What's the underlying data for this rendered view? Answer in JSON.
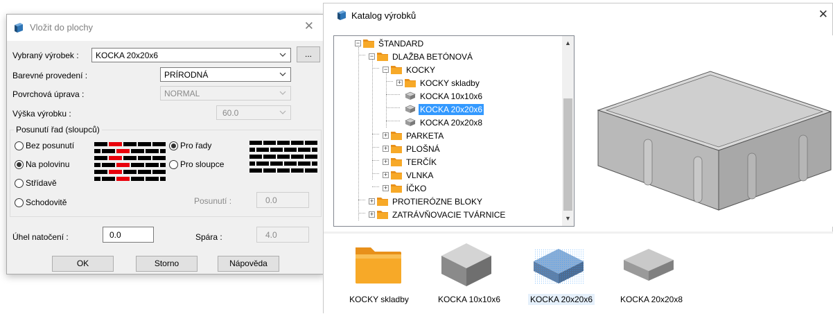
{
  "dialog": {
    "title": "Vložit do plochy",
    "product_label": "Vybraný výrobek :",
    "product_value": "KOCKA 20x20x6",
    "browse_label": "...",
    "color_label": "Barevné provedení :",
    "color_value": "PRÍRODNÁ",
    "surface_label": "Povrchová úprava :",
    "surface_value": "NORMAL",
    "height_label": "Výška výrobku :",
    "height_value": "60.0",
    "shift_group": "Posunutí řad (sloupců)",
    "shift_options": [
      "Bez posunutí",
      "Na polovinu",
      "Střídavě",
      "Schodovitě"
    ],
    "shift_selected": 1,
    "direction_options": [
      "Pro řady",
      "Pro sloupce"
    ],
    "direction_selected": 0,
    "offset_label": "Posunutí :",
    "offset_value": "0.0",
    "angle_label": "Úhel natočení :",
    "angle_value": "0.0",
    "gap_label": "Spára :",
    "gap_value": "4.0",
    "ok_label": "OK",
    "cancel_label": "Storno",
    "help_label": "Nápověda",
    "close_glyph": "✕"
  },
  "catalog": {
    "title": "Katalog výrobků",
    "close_glyph": "✕",
    "tree": [
      {
        "label": "ŠTANDARD",
        "level": 0,
        "type": "folder",
        "expanded": true
      },
      {
        "label": "DLAŽBA BETÓNOVÁ",
        "level": 1,
        "type": "folder",
        "expanded": true
      },
      {
        "label": "KOCKY",
        "level": 2,
        "type": "folder",
        "expanded": true
      },
      {
        "label": "KOCKY skladby",
        "level": 3,
        "type": "folder",
        "expanded": false
      },
      {
        "label": "KOCKA 10x10x6",
        "level": 3,
        "type": "item"
      },
      {
        "label": "KOCKA 20x20x6",
        "level": 3,
        "type": "item",
        "selected": true
      },
      {
        "label": "KOCKA 20x20x8",
        "level": 3,
        "type": "item"
      },
      {
        "label": "PARKETA",
        "level": 2,
        "type": "folder",
        "expanded": false
      },
      {
        "label": "PLOŠNÁ",
        "level": 2,
        "type": "folder",
        "expanded": false
      },
      {
        "label": "TERČÍK",
        "level": 2,
        "type": "folder",
        "expanded": false
      },
      {
        "label": "VLNKA",
        "level": 2,
        "type": "folder",
        "expanded": false
      },
      {
        "label": "ÍČKO",
        "level": 2,
        "type": "folder",
        "expanded": false
      },
      {
        "label": "PROTIERÓZNE BLOKY",
        "level": 1,
        "type": "folder",
        "expanded": false
      },
      {
        "label": "ZATRÁVŇOVACIE TVÁRNICE",
        "level": 1,
        "type": "folder",
        "expanded": false
      }
    ],
    "items": [
      {
        "label": "KOCKY skladby",
        "kind": "folder"
      },
      {
        "label": "KOCKA 10x10x6",
        "kind": "tile-tall"
      },
      {
        "label": "KOCKA 20x20x6",
        "kind": "tile-selected",
        "selected": true
      },
      {
        "label": "KOCKA 20x20x8",
        "kind": "tile-flat"
      }
    ]
  },
  "colors": {
    "selection": "#3399ff",
    "brick_red": "#e8000b",
    "brick_black": "#000000",
    "folder": "#f7a928"
  },
  "icons": [
    "app-icon",
    "close-icon",
    "chevron-down-icon",
    "folder-icon",
    "paver-item-icon"
  ]
}
